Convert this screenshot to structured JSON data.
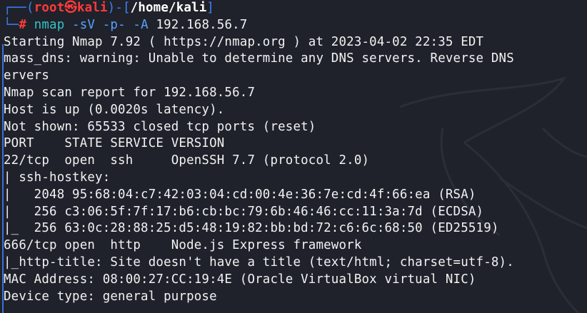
{
  "prompt": {
    "corner_top": "┌──(",
    "user": "root",
    "at_glyph": "㉿",
    "host": "kali",
    "close_paren": ")-[",
    "path": "/home/kali",
    "close_bracket": "]",
    "corner_bottom": "└─",
    "hash": "#",
    "command": "nmap",
    "flag1": "-sV",
    "flag2": "-p-",
    "flag3": "-A",
    "target": "192.168.56.7"
  },
  "output_lines": [
    "Starting Nmap 7.92 ( https://nmap.org ) at 2023-04-02 22:35 EDT",
    "mass_dns: warning: Unable to determine any DNS servers. Reverse DNS",
    "ervers",
    "Nmap scan report for 192.168.56.7",
    "Host is up (0.0020s latency).",
    "Not shown: 65533 closed tcp ports (reset)",
    "PORT    STATE SERVICE VERSION",
    "22/tcp  open  ssh     OpenSSH 7.7 (protocol 2.0)",
    "| ssh-hostkey:",
    "|   2048 95:68:04:c7:42:03:04:cd:00:4e:36:7e:cd:4f:66:ea (RSA)",
    "|   256 c3:06:5f:7f:17:b6:cb:bc:79:6b:46:46:cc:11:3a:7d (ECDSA)",
    "|_  256 63:0c:28:88:25:d5:48:19:82:bb:bd:72:c6:6c:68:50 (ED25519)",
    "666/tcp open  http    Node.js Express framework",
    "|_http-title: Site doesn't have a title (text/html; charset=utf-8).",
    "MAC Address: 08:00:27:CC:19:4E (Oracle VirtualBox virtual NIC)",
    "Device type: general purpose"
  ],
  "colors": {
    "background": "#1f222b",
    "prompt_blue": "#3b82f6",
    "prompt_red": "#ff3b3b",
    "command_cyan": "#36c1c7",
    "option_blue": "#5aa0ff",
    "text": "#f2f2f2"
  },
  "icons": {
    "background": "kali-dragon-watermark"
  }
}
